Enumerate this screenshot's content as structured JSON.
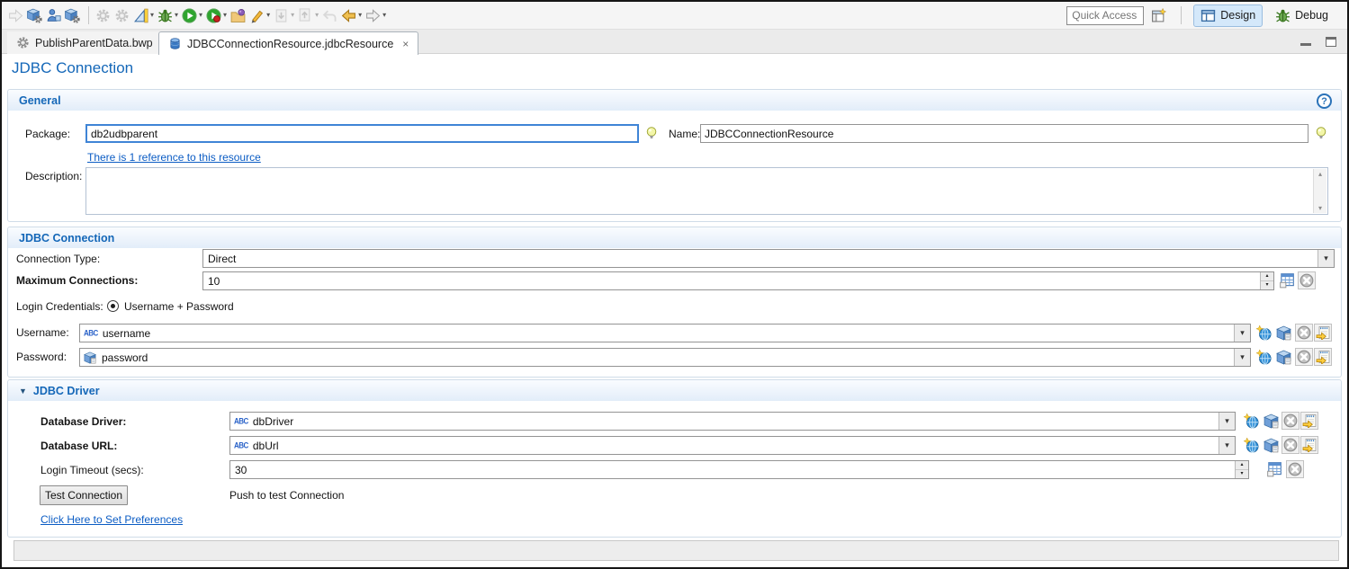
{
  "toolbar": {
    "quick_access_placeholder": "Quick Access",
    "design_label": "Design",
    "debug_label": "Debug"
  },
  "tabs": {
    "tab1": "PublishParentData.bwp",
    "tab2": "JDBCConnectionResource.jdbcResource"
  },
  "editor": {
    "title": "JDBC Connection"
  },
  "general": {
    "header": "General",
    "package_label": "Package:",
    "package_value": "db2udbparent",
    "name_label": "Name:",
    "name_value": "JDBCConnectionResource",
    "reference_link": "There is 1 reference to this resource",
    "description_label": "Description:",
    "description_value": ""
  },
  "connection": {
    "header": "JDBC Connection",
    "connection_type_label": "Connection Type:",
    "connection_type_value": "Direct",
    "max_connections_label": "Maximum Connections:",
    "max_connections_value": "10",
    "login_credentials_label": "Login Credentials:",
    "login_credentials_selected": "Username + Password",
    "username_label": "Username:",
    "username_value": "username",
    "password_label": "Password:",
    "password_value": "password"
  },
  "driver": {
    "header": "JDBC Driver",
    "database_driver_label": "Database Driver:",
    "database_driver_value": "dbDriver",
    "database_url_label": "Database URL:",
    "database_url_value": "dbUrl",
    "login_timeout_label": "Login Timeout (secs):",
    "login_timeout_value": "30",
    "test_button_label": "Test Connection",
    "test_hint": "Push to test Connection",
    "preferences_link": "Click Here to Set Preferences"
  },
  "icons": {
    "abc": "ABC",
    "help": "?",
    "chevron_down": "▾",
    "spin_up": "▴",
    "spin_down": "▾",
    "scroll_up": "▴",
    "scroll_down": "▾",
    "close_tab": "×",
    "collapse_arrow": "▼",
    "menu_caret": "▾"
  },
  "colors": {
    "heading_blue": "#1467b8",
    "link_blue": "#0b5cc4",
    "focus_border": "#3f84d6"
  }
}
